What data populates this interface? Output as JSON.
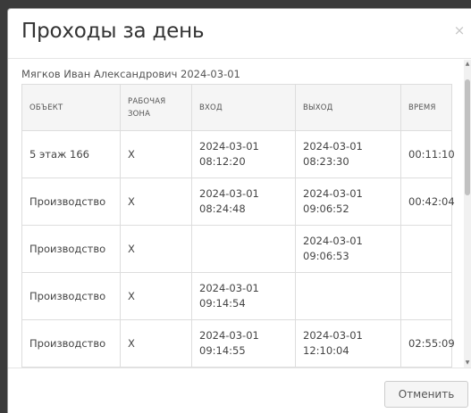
{
  "dialog": {
    "title": "Проходы за день",
    "close_glyph": "×",
    "person_line": "Мягков Иван Александрович 2024-03-01"
  },
  "table": {
    "headers": {
      "object": "ОБЪЕКТ",
      "work_zone": "РАБОЧАЯ ЗОНА",
      "entry": "ВХОД",
      "exit": "ВЫХОД",
      "time": "ВРЕМЯ"
    },
    "rows": [
      {
        "object": "5 этаж 166",
        "work_zone": "X",
        "entry_date": "2024-03-01",
        "entry_time": "08:12:20",
        "exit_date": "2024-03-01",
        "exit_time": "08:23:30",
        "duration": "00:11:10"
      },
      {
        "object": "Производство",
        "work_zone": "X",
        "entry_date": "2024-03-01",
        "entry_time": "08:24:48",
        "exit_date": "2024-03-01",
        "exit_time": "09:06:52",
        "duration": "00:42:04"
      },
      {
        "object": "Производство",
        "work_zone": "X",
        "entry_date": "",
        "entry_time": "",
        "exit_date": "2024-03-01",
        "exit_time": "09:06:53",
        "duration": ""
      },
      {
        "object": "Производство",
        "work_zone": "X",
        "entry_date": "2024-03-01",
        "entry_time": "09:14:54",
        "exit_date": "",
        "exit_time": "",
        "duration": ""
      },
      {
        "object": "Производство",
        "work_zone": "X",
        "entry_date": "2024-03-01",
        "entry_time": "09:14:55",
        "exit_date": "2024-03-01",
        "exit_time": "12:10:04",
        "duration": "02:55:09"
      }
    ]
  },
  "scrollbar": {
    "up_glyph": "▲",
    "down_glyph": "▼"
  },
  "footer": {
    "cancel_label": "Отменить"
  }
}
